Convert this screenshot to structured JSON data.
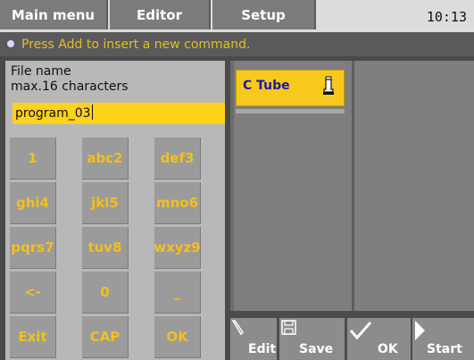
{
  "tabs": [
    {
      "label": "Main menu"
    },
    {
      "label": "Editor"
    },
    {
      "label": "Setup"
    }
  ],
  "clock": "10:13",
  "status_message": "Press Add to insert a new command.",
  "file_name": {
    "title": "File name",
    "hint": "max.16 characters",
    "value": "program_03"
  },
  "keypad": [
    [
      "1",
      "abc2",
      "def3"
    ],
    [
      "ghi4",
      "jkl5",
      "mno6"
    ],
    [
      "pqrs7",
      "tuv8",
      "wxyz9"
    ],
    [
      "<-",
      "0",
      "_"
    ],
    [
      "Exit",
      "CAP",
      "OK"
    ]
  ],
  "command_list": [
    {
      "label": "C Tube",
      "icon": "tube-icon"
    }
  ],
  "toolbar": {
    "edit": "Edit",
    "save": "Save",
    "ok": "OK",
    "start": "Start"
  },
  "colors": {
    "accent": "#f2c01e",
    "input_bg": "#ffd21c",
    "tab_bg": "#7c7c7c",
    "status_text": "#e3bd2a"
  }
}
